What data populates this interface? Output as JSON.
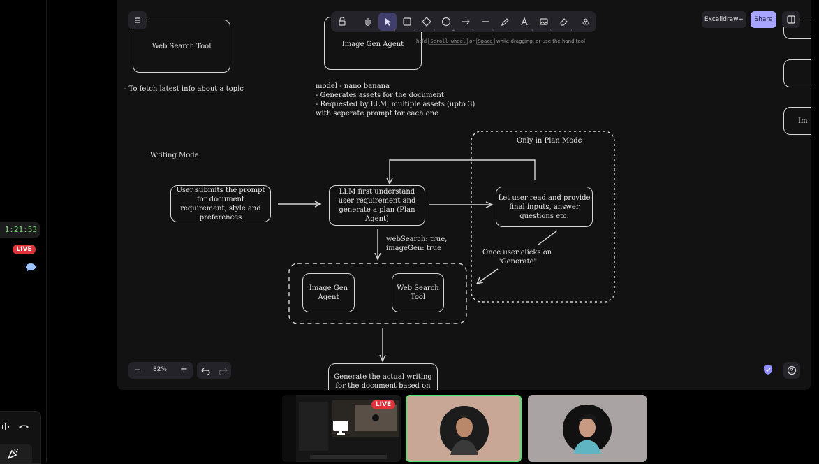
{
  "call": {
    "timer": "1:21:53",
    "live_badge": "LIVE"
  },
  "toolbar": {
    "tools": [
      "lock-icon",
      "hand-icon",
      "selection-icon",
      "rectangle-icon",
      "diamond-icon",
      "ellipse-icon",
      "arrow-icon",
      "line-icon",
      "draw-icon",
      "text-icon",
      "image-icon",
      "eraser-icon",
      "more-tools-icon"
    ],
    "shortcut_numbers": [
      "1",
      "2",
      "3",
      "4",
      "5",
      "6",
      "7",
      "8",
      "9",
      "0"
    ],
    "excalidraw_plus": "Excalidraw+",
    "share": "Share",
    "hint_prefix": "hold",
    "hint_key1": "Scroll wheel",
    "hint_or": "or",
    "hint_key2": "Space",
    "hint_suffix": "while dragging, or use the hand tool"
  },
  "zoom": {
    "minus": "−",
    "level": "82%",
    "plus": "+"
  },
  "diagram": {
    "web_search_box": "Web Search Tool",
    "web_search_note": "- To fetch latest info about a topic",
    "image_gen_box": "Image Gen Agent",
    "image_gen_notes": [
      "model - nano banana",
      "- Generates assets for the document",
      "- Requested by LLM, multiple assets (upto 3)",
      "with seperate prompt for each one"
    ],
    "writing_mode": "Writing Mode",
    "plan_mode_label": "Only in Plan Mode",
    "user_submits": "User submits the prompt for document requirement, style and preferences",
    "llm_plan": "LLM first understand user requirement and generate a plan (Plan Agent)",
    "user_read": "Let user read and provide final inputs, answer questions etc.",
    "flags": [
      "webSearch: true,",
      "imageGen: true"
    ],
    "generate_click": [
      "Once user clicks on",
      "\"Generate\""
    ],
    "tool_image_gen": "Image Gen Agent",
    "tool_web_search": "Web Search Tool",
    "generate_writing": [
      "Generate the actual writing",
      "for the document based on"
    ],
    "right_edge_label": "Im"
  }
}
